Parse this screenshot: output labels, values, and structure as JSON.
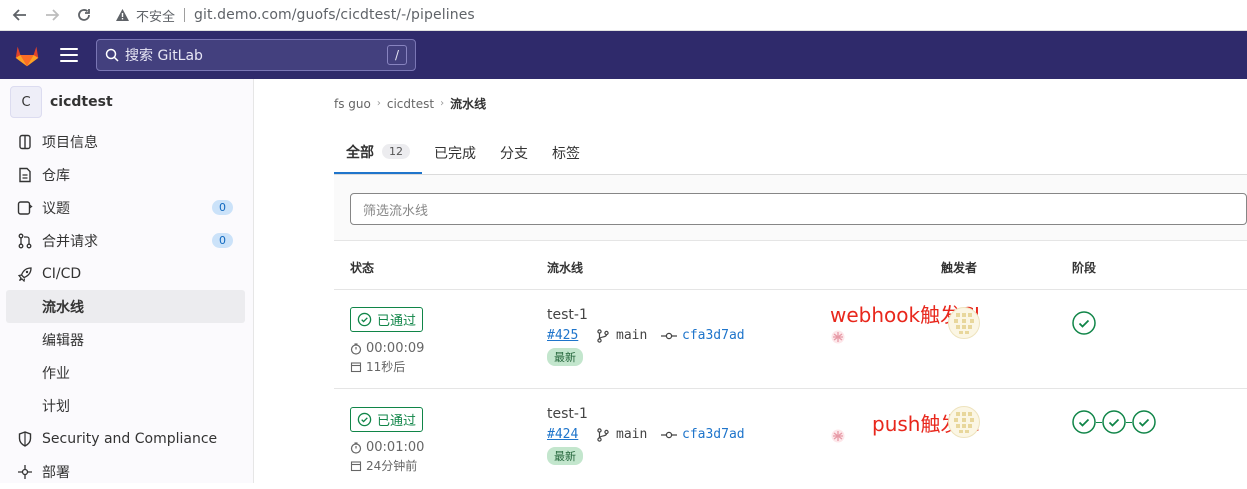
{
  "browser": {
    "insecure_label": "不安全",
    "url": "git.demo.com/guofs/cicdtest/-/pipelines"
  },
  "topbar": {
    "search_placeholder": "搜索 GitLab",
    "search_shortcut": "/"
  },
  "sidebar": {
    "project_initial": "C",
    "project_name": "cicdtest",
    "items": [
      {
        "label": "项目信息",
        "icon": "project-info-icon"
      },
      {
        "label": "仓库",
        "icon": "repository-icon"
      },
      {
        "label": "议题",
        "icon": "issues-icon",
        "count": "0"
      },
      {
        "label": "合并请求",
        "icon": "merge-request-icon",
        "count": "0"
      },
      {
        "label": "CI/CD",
        "icon": "rocket-icon"
      }
    ],
    "cicd_sub": [
      {
        "label": "流水线",
        "active": true
      },
      {
        "label": "编辑器"
      },
      {
        "label": "作业"
      },
      {
        "label": "计划"
      }
    ],
    "more_items": [
      {
        "label": "Security and Compliance",
        "icon": "shield-icon"
      },
      {
        "label": "部署",
        "icon": "deployments-icon"
      }
    ]
  },
  "breadcrumb": {
    "items": [
      "fs guo",
      "cicdtest",
      "流水线"
    ]
  },
  "tabs": [
    {
      "label": "全部",
      "count": "12",
      "active": true
    },
    {
      "label": "已完成"
    },
    {
      "label": "分支"
    },
    {
      "label": "标签"
    }
  ],
  "filter": {
    "placeholder": "筛选流水线"
  },
  "table": {
    "headers": {
      "status": "状态",
      "pipeline": "流水线",
      "triggerer": "触发者",
      "stages": "阶段"
    },
    "rows": [
      {
        "status": "已通过",
        "duration": "00:00:09",
        "finished": "11秒后",
        "name": "test-1",
        "id": "#425",
        "branch": "main",
        "commit": "cfa3d7ad",
        "tag": "最新",
        "annotation": "webhook触发CI",
        "stages_passed": 1
      },
      {
        "status": "已通过",
        "duration": "00:01:00",
        "finished": "24分钟前",
        "name": "test-1",
        "id": "#424",
        "branch": "main",
        "commit": "cfa3d7ad",
        "tag": "最新",
        "annotation": "push触发CI",
        "stages_passed": 3
      }
    ]
  },
  "colors": {
    "topbar": "#2f2a6b",
    "success": "#108548",
    "link": "#1f75cb",
    "annotation": "#e8271c"
  }
}
